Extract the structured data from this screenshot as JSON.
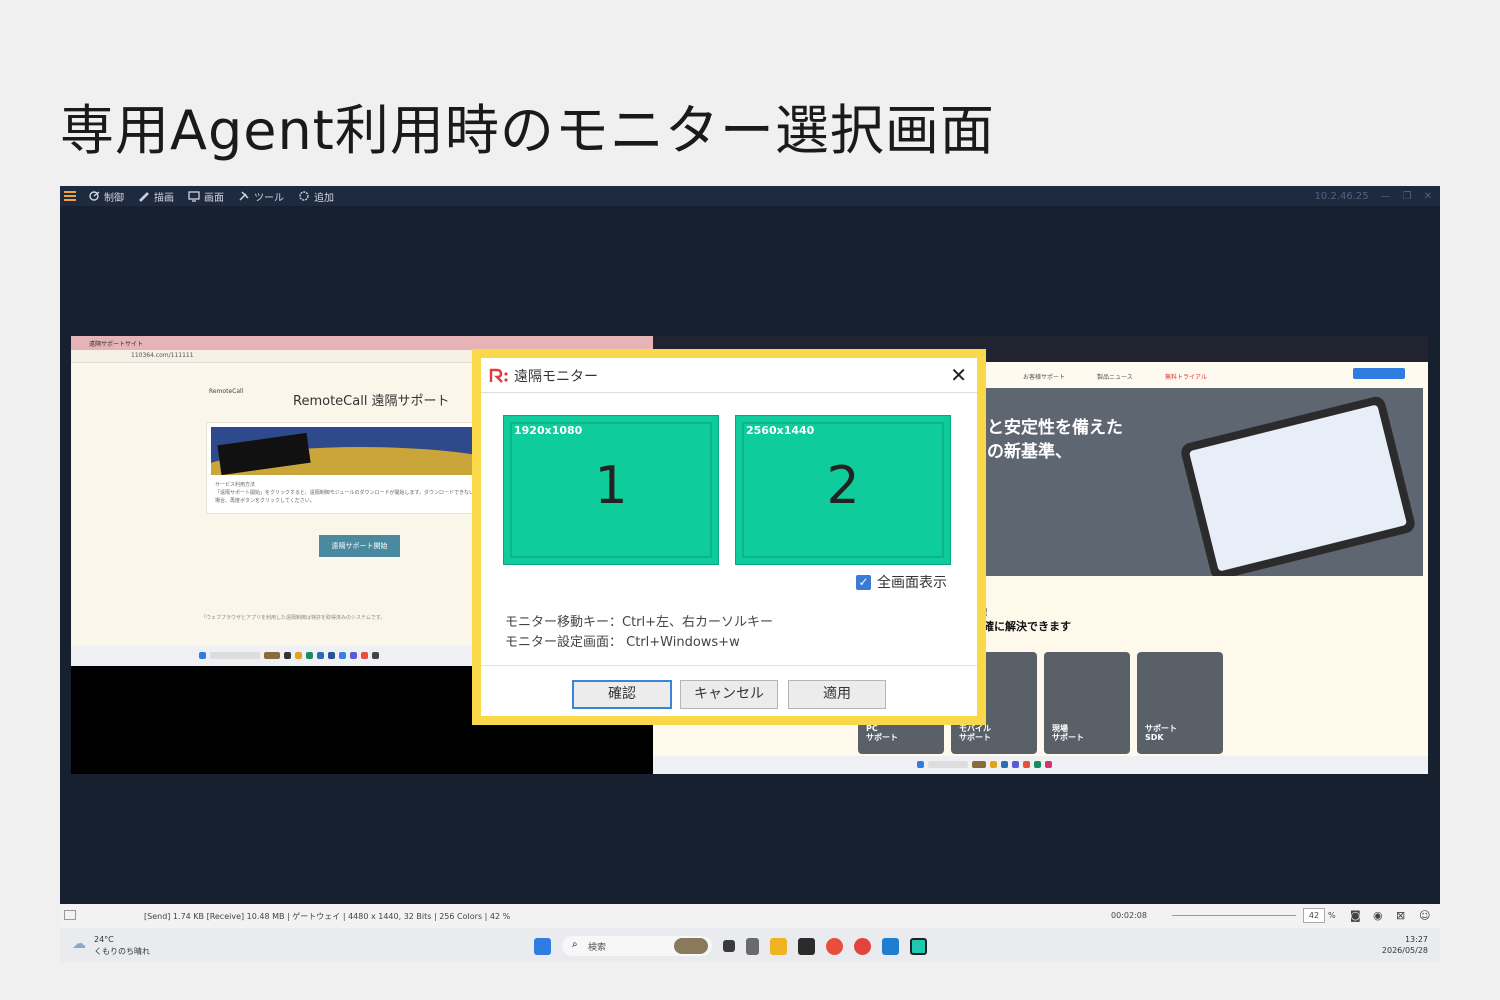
{
  "slide": {
    "title": "専用Agent利用時のモニター選択画面"
  },
  "toolbar": {
    "items": [
      {
        "icon": "control-icon",
        "label": "制御"
      },
      {
        "icon": "draw-icon",
        "label": "描画"
      },
      {
        "icon": "screen-icon",
        "label": "画面"
      },
      {
        "icon": "tools-icon",
        "label": "ツール"
      },
      {
        "icon": "add-icon",
        "label": "追加"
      }
    ],
    "connection": "10.2.46.25"
  },
  "remote_screen1": {
    "tab": "遠隔サポートサイト",
    "url": "110364.com/111111",
    "logo": "RemoteCall",
    "heading": "RemoteCall 遠隔サポート",
    "card_title": "サービス利用方法",
    "card_text": "「遠隔サポート開始」をクリックすると、遠隔制御モジュールのダウンロードが開始します。ダウンロードできない場合、再度ボタンをクリックしてください。",
    "button": "遠隔サポート開始",
    "footer": "「ウェブブラウザとアプリを利用した遠隔制御は特許を取得済みのシステムです。"
  },
  "remote_screen2": {
    "menu": [
      "お客様サポート",
      "製品ニュース",
      "無料トライアル"
    ],
    "hero_text": "と安定性を備えた\nの新基準、",
    "lower_text": "!\n確に解決できます",
    "tiles": [
      "PC\nサポート",
      "モバイル\nサポート",
      "現場\nサポート",
      "サポート\nSDK"
    ]
  },
  "dialog": {
    "title": "遠隔モニター",
    "monitors": [
      {
        "resolution": "1920x1080",
        "number": "1"
      },
      {
        "resolution": "2560x1440",
        "number": "2"
      }
    ],
    "fullscreen_label": "全画面表示",
    "fullscreen_checked": true,
    "hint_line1": "モニター移動キー：Ctrl+左、右カーソルキー",
    "hint_line2": "モニター設定画面：  Ctrl+Windows+w",
    "buttons": {
      "confirm": "確認",
      "cancel": "キャンセル",
      "apply": "適用"
    }
  },
  "status_bar": {
    "info": "[Send] 1.74 KB  [Receive] 10.48 MB | ゲートウェイ | 4480 x 1440, 32 Bits | 256 Colors | 42 %",
    "elapsed": "00:02:08",
    "zoom": "42",
    "zoom_unit": "%"
  },
  "taskbar": {
    "weather_temp": "24°C",
    "weather_desc": "くもりのち晴れ",
    "search_placeholder": "検索",
    "time": "13:27",
    "date": "2026/05/28"
  },
  "colors": {
    "accent_yellow": "#f9d84a",
    "monitor_green": "#0fcc9c",
    "app_bg": "#16202e"
  }
}
